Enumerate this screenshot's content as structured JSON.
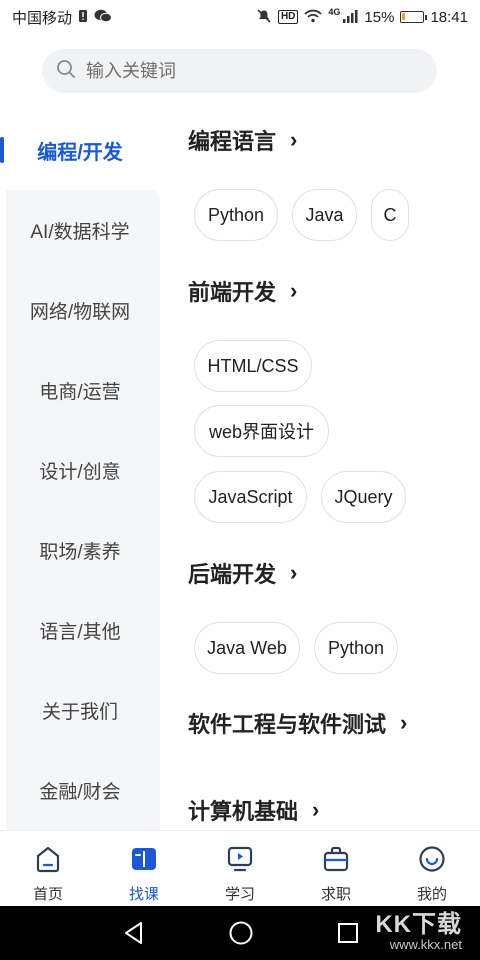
{
  "status_bar": {
    "carrier": "中国移动",
    "hd_badge": "HD",
    "network": "4G",
    "battery_percent": "15%",
    "battery_level": 0.15,
    "time": "18:41"
  },
  "search": {
    "placeholder": "输入关键词"
  },
  "sidebar": {
    "items": [
      {
        "label": "编程/开发",
        "active": true
      },
      {
        "label": "AI/数据科学"
      },
      {
        "label": "网络/物联网"
      },
      {
        "label": "电商/运营"
      },
      {
        "label": "设计/创意"
      },
      {
        "label": "职场/素养"
      },
      {
        "label": "语言/其他"
      },
      {
        "label": "关于我们"
      },
      {
        "label": "金融/财会"
      }
    ]
  },
  "sections": [
    {
      "title": "编程语言",
      "tags": [
        "Python",
        "Java",
        "C"
      ]
    },
    {
      "title": "前端开发",
      "tags": [
        "HTML/CSS",
        "web界面设计",
        "JavaScript",
        "JQuery"
      ]
    },
    {
      "title": "后端开发",
      "tags": [
        "Java Web",
        "Python"
      ]
    },
    {
      "title": "软件工程与软件测试",
      "tags": []
    },
    {
      "title": "计算机基础",
      "tags": []
    }
  ],
  "bottom_nav": {
    "items": [
      {
        "label": "首页",
        "icon": "home-icon"
      },
      {
        "label": "找课",
        "icon": "book-icon",
        "active": true
      },
      {
        "label": "学习",
        "icon": "play-screen-icon"
      },
      {
        "label": "求职",
        "icon": "briefcase-icon"
      },
      {
        "label": "我的",
        "icon": "smile-icon"
      }
    ]
  },
  "watermark": {
    "logo": "KK下载",
    "url": "www.kkx.net"
  },
  "colors": {
    "accent": "#1a58d8",
    "battery": "#f29b2e"
  }
}
